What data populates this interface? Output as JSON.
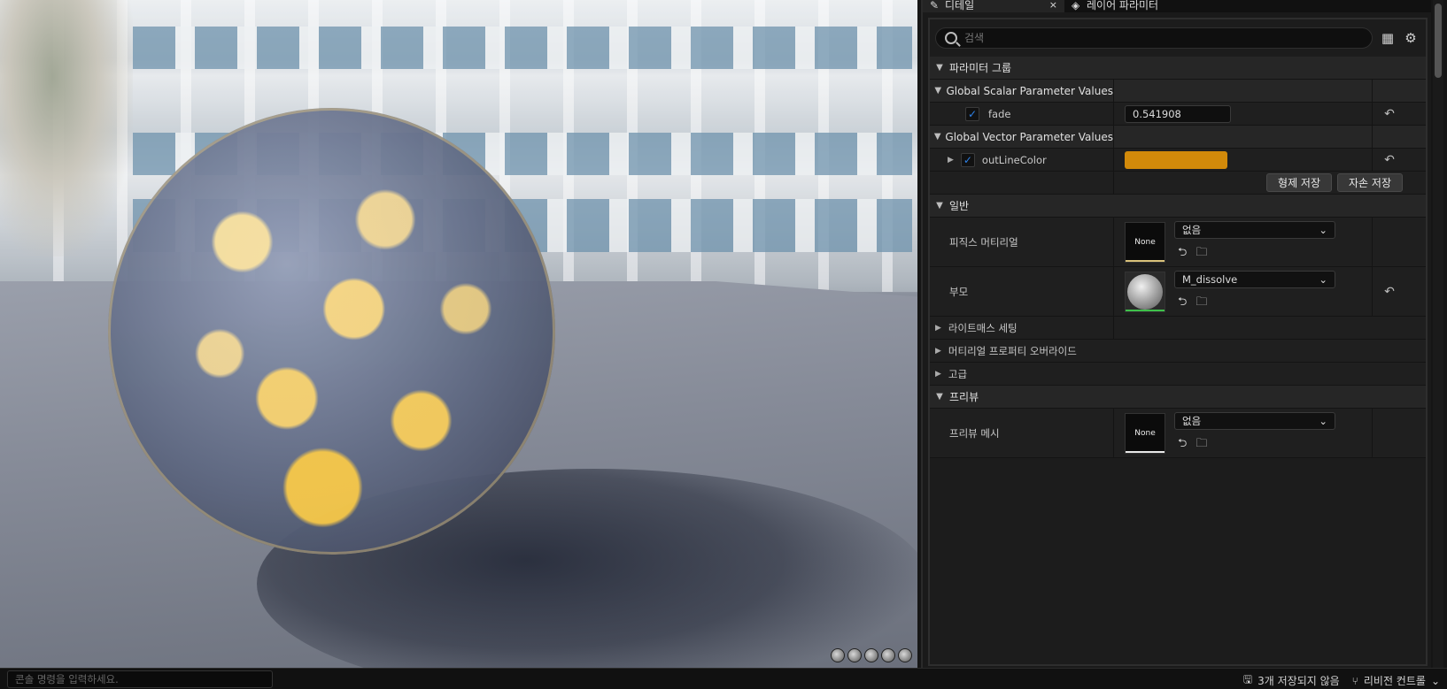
{
  "tabs": [
    {
      "label": "디테일",
      "icon": "pencil-icon",
      "close": "×"
    },
    {
      "label": "레이어 파라미터",
      "icon": "layers-icon"
    }
  ],
  "search": {
    "placeholder": "검색"
  },
  "categories": {
    "param_group": "파라미터 그룹",
    "scalar": "Global Scalar Parameter Values",
    "vector": "Global Vector Parameter Values",
    "general": "일반",
    "lightmass": "라이트매스 세팅",
    "override": "머티리얼 프로퍼티 오버라이드",
    "advanced": "고급",
    "preview": "프리뷰"
  },
  "params": {
    "fade": {
      "name": "fade",
      "value": "0.541908",
      "checked": true
    },
    "outline": {
      "name": "outLineColor",
      "color": "#D28A0A",
      "checked": true
    }
  },
  "buttons": {
    "save_sibling": "형제 저장",
    "save_child": "자손 저장"
  },
  "general": {
    "phys_label": "피직스 머티리얼",
    "phys_thumb": "None",
    "phys_value": "없음",
    "parent_label": "부모",
    "parent_value": "M_dissolve"
  },
  "preview": {
    "mesh_label": "프리뷰 메시",
    "mesh_thumb": "None",
    "mesh_value": "없음"
  },
  "bottom": {
    "console_placeholder": "콘솔 명령을 입력하세요.",
    "unsaved": "3개 저장되지 않음",
    "revision": "리비전 컨트롤"
  },
  "colors": {
    "accent_check": "#2E82E8",
    "outline_swatch": "#D28A0A"
  }
}
